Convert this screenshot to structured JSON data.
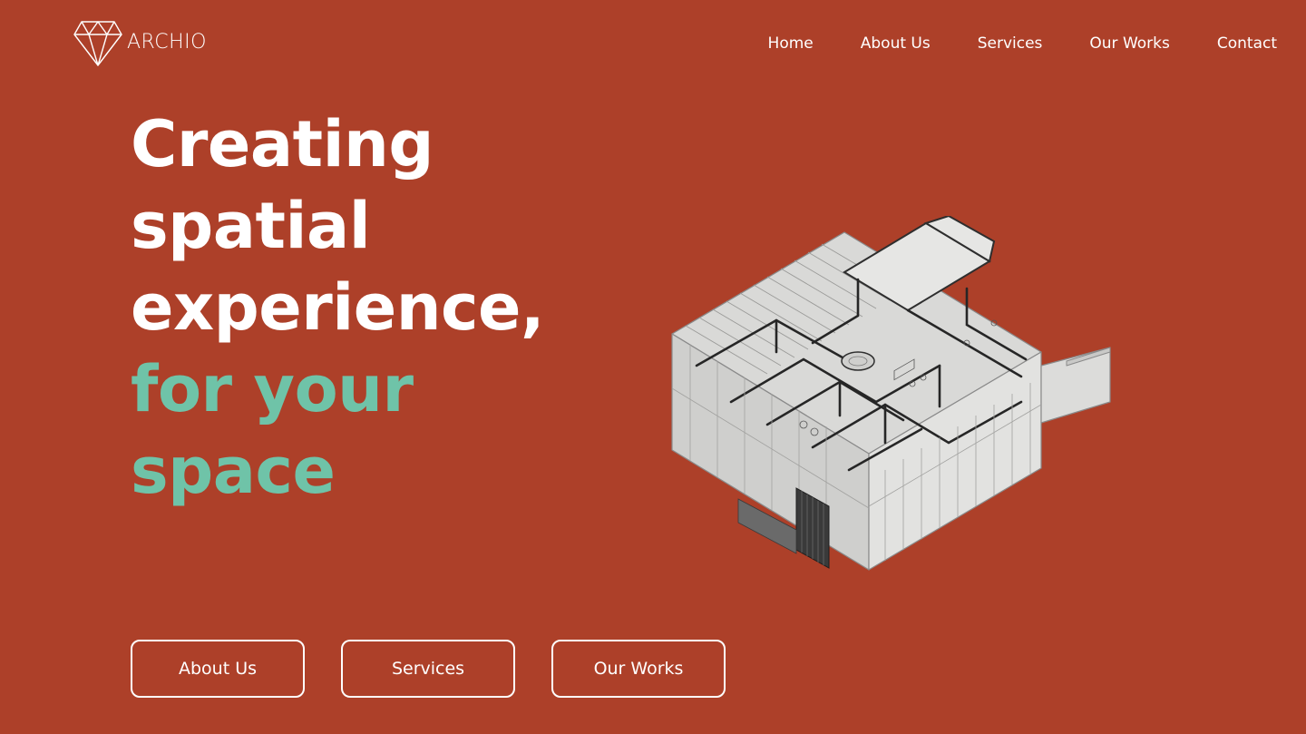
{
  "brand": {
    "name": "ARCHIO",
    "logo_icon": "diamond-icon"
  },
  "nav": {
    "items": [
      {
        "label": "Home"
      },
      {
        "label": "About Us"
      },
      {
        "label": "Services"
      },
      {
        "label": "Our Works"
      },
      {
        "label": "Contact"
      }
    ]
  },
  "hero": {
    "line1": "Creating",
    "line2": "spatial",
    "line3": "experience,",
    "line4": "for your",
    "line5": "space",
    "illustration": "isometric-floor-plan-illustration"
  },
  "cta": {
    "about_label": "About Us",
    "services_label": "Services",
    "works_label": "Our Works"
  },
  "colors": {
    "background": "#ad4029",
    "text": "#ffffff",
    "accent": "#6fc3a8"
  }
}
